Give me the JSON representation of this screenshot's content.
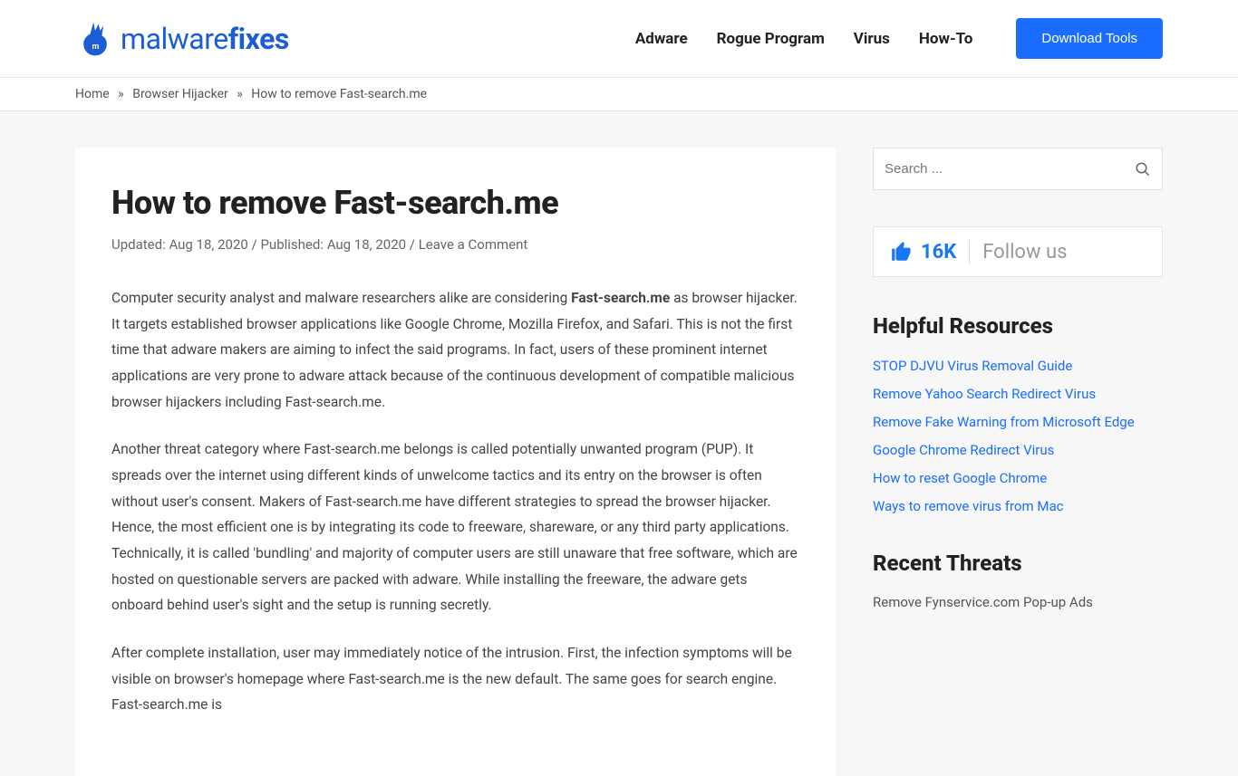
{
  "logo": {
    "prefix": "malware",
    "suffix": "fixes"
  },
  "nav": {
    "adware": "Adware",
    "rogue": "Rogue Program",
    "virus": "Virus",
    "howto": "How-To",
    "cta": "Download Tools"
  },
  "breadcrumb": {
    "home": "Home",
    "cat": "Browser Hijacker",
    "current": "How to remove Fast-search.me",
    "sep": "»"
  },
  "article": {
    "title": "How to remove Fast-search.me",
    "meta_updated": "Updated: Aug 18, 2020",
    "meta_published": "Published: Aug 18, 2020",
    "meta_comment": "Leave a Comment",
    "meta_slash": " / ",
    "p1_a": "Computer security analyst and malware researchers alike are considering ",
    "p1_bold": "Fast-search.me",
    "p1_b": " as browser hijacker. It targets established browser applications like Google Chrome, Mozilla Firefox, and Safari. This is not the first time that adware makers are aiming to infect the said programs. In fact, users of these prominent internet applications are very prone to adware attack because of the continuous development of compatible malicious browser hijackers including Fast-search.me.",
    "p2": "Another threat category where Fast-search.me belongs is called potentially unwanted program (PUP). It spreads over the internet using different kinds of unwelcome tactics and its entry on the browser is often without user's consent. Makers of Fast-search.me have different strategies to spread the browser hijacker. Hence, the most efficient one is by integrating its code to freeware, shareware, or any third party applications. Technically, it is called 'bundling' and majority of computer users are still unaware that free software, which are hosted on questionable servers are packed with adware. While installing the freeware, the adware gets onboard behind user's sight and the setup is running secretly.",
    "p3": "After complete installation, user may immediately notice of the intrusion. First, the infection symptoms will be visible on browser's homepage where Fast-search.me is the new default. The same goes for search engine. Fast-search.me is"
  },
  "search": {
    "placeholder": "Search ..."
  },
  "fb": {
    "count": "16K",
    "follow": "Follow us"
  },
  "resources": {
    "title": "Helpful Resources",
    "items": [
      "STOP DJVU Virus Removal Guide",
      "Remove Yahoo Search Redirect Virus",
      "Remove Fake Warning from Microsoft Edge",
      "Google Chrome Redirect Virus",
      "How to reset Google Chrome",
      "Ways to remove virus from Mac"
    ]
  },
  "threats": {
    "title": "Recent Threats",
    "item0": "Remove Fynservice.com Pop-up Ads"
  }
}
